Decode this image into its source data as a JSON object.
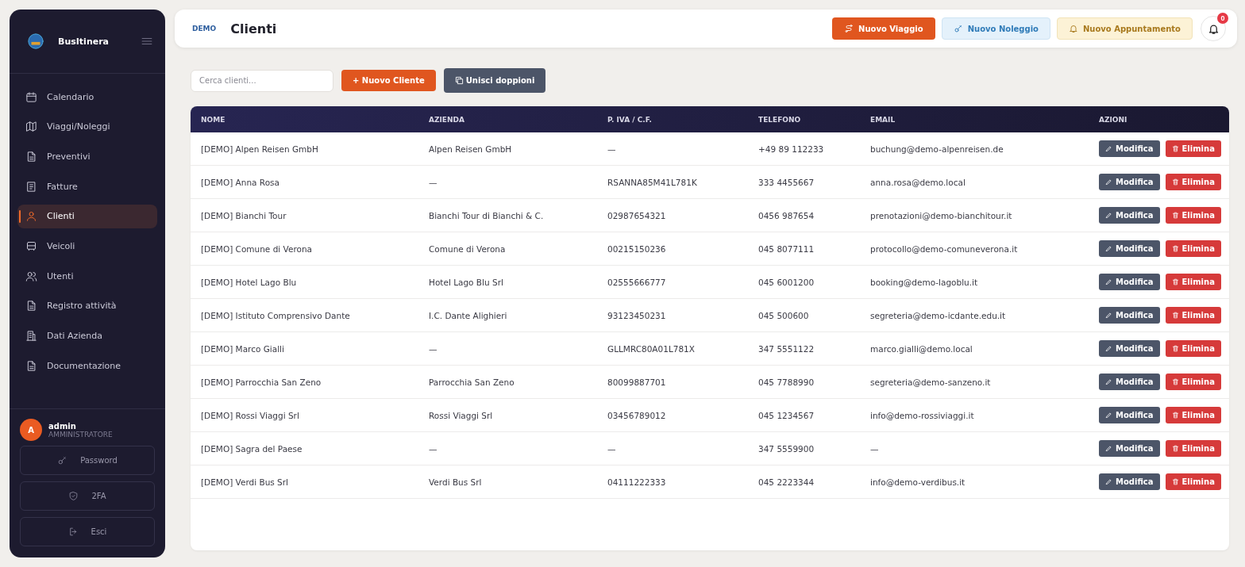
{
  "sidebar": {
    "brand": "BusItinera",
    "items": [
      {
        "label": "Calendario",
        "selected": false
      },
      {
        "label": "Viaggi/Noleggi",
        "selected": false
      },
      {
        "label": "Preventivi",
        "selected": false
      },
      {
        "label": "Fatture",
        "selected": false
      },
      {
        "label": "Clienti",
        "selected": true
      },
      {
        "label": "Veicoli",
        "selected": false
      },
      {
        "label": "Utenti",
        "selected": false
      },
      {
        "label": "Registro attività",
        "selected": false
      },
      {
        "label": "Dati Azienda",
        "selected": false
      },
      {
        "label": "Documentazione",
        "selected": false
      }
    ],
    "user": {
      "initial": "A",
      "name": "admin",
      "role": "AMMINISTRATORE"
    },
    "buttons": [
      "Password",
      "2FA",
      "Esci"
    ]
  },
  "header": {
    "demo_tag": "DEMO",
    "title": "Clienti",
    "actions": [
      {
        "label": "Nuovo Viaggio",
        "kind": "primary"
      },
      {
        "label": "Nuovo Noleggio",
        "kind": "info"
      },
      {
        "label": "Nuovo Appuntamento",
        "kind": "warning"
      }
    ],
    "notifications": "0"
  },
  "toolbar": {
    "search": {
      "placeholder": "Cerca clienti..."
    },
    "new_button": "+ Nuovo Cliente",
    "merge_button": "Unisci doppioni"
  },
  "table": {
    "columns": [
      "NOME",
      "AZIENDA",
      "P. IVA / C.F.",
      "TELEFONO",
      "EMAIL",
      "AZIONI"
    ],
    "rows": [
      {
        "cells": [
          "[DEMO] Alpen Reisen GmbH",
          "Alpen Reisen GmbH",
          "—",
          "+49 89 112233",
          "buchung@demo-alpenreisen.de"
        ],
        "actions": [
          "Modifica",
          "Elimina"
        ]
      },
      {
        "cells": [
          "[DEMO] Anna Rosa",
          "—",
          "RSANNA85M41L781K",
          "333 4455667",
          "anna.rosa@demo.local"
        ],
        "actions": [
          "Modifica",
          "Elimina"
        ]
      },
      {
        "cells": [
          "[DEMO] Bianchi Tour",
          "Bianchi Tour di Bianchi & C.",
          "02987654321",
          "0456 987654",
          "prenotazioni@demo-bianchitour.it"
        ],
        "actions": [
          "Modifica",
          "Elimina"
        ]
      },
      {
        "cells": [
          "[DEMO] Comune di Verona",
          "Comune di Verona",
          "00215150236",
          "045 8077111",
          "protocollo@demo-comuneverona.it"
        ],
        "actions": [
          "Modifica",
          "Elimina"
        ]
      },
      {
        "cells": [
          "[DEMO] Hotel Lago Blu",
          "Hotel Lago Blu Srl",
          "02555666777",
          "045 6001200",
          "booking@demo-lagoblu.it"
        ],
        "actions": [
          "Modifica",
          "Elimina"
        ]
      },
      {
        "cells": [
          "[DEMO] Istituto Comprensivo Dante",
          "I.C. Dante Alighieri",
          "93123450231",
          "045 500600",
          "segreteria@demo-icdante.edu.it"
        ],
        "actions": [
          "Modifica",
          "Elimina"
        ]
      },
      {
        "cells": [
          "[DEMO] Marco Gialli",
          "—",
          "GLLMRC80A01L781X",
          "347 5551122",
          "marco.gialli@demo.local"
        ],
        "actions": [
          "Modifica",
          "Elimina"
        ]
      },
      {
        "cells": [
          "[DEMO] Parrocchia San Zeno",
          "Parrocchia San Zeno",
          "80099887701",
          "045 7788990",
          "segreteria@demo-sanzeno.it"
        ],
        "actions": [
          "Modifica",
          "Elimina"
        ]
      },
      {
        "cells": [
          "[DEMO] Rossi Viaggi Srl",
          "Rossi Viaggi Srl",
          "03456789012",
          "045 1234567",
          "info@demo-rossiviaggi.it"
        ],
        "actions": [
          "Modifica",
          "Elimina"
        ]
      },
      {
        "cells": [
          "[DEMO] Sagra del Paese",
          "—",
          "—",
          "347 5559900",
          "—"
        ],
        "actions": [
          "Modifica",
          "Elimina"
        ]
      },
      {
        "cells": [
          "[DEMO] Verdi Bus Srl",
          "Verdi Bus Srl",
          "04111222333",
          "045 2223344",
          "info@demo-verdibus.it"
        ],
        "actions": [
          "Modifica",
          "Elimina"
        ]
      }
    ]
  }
}
